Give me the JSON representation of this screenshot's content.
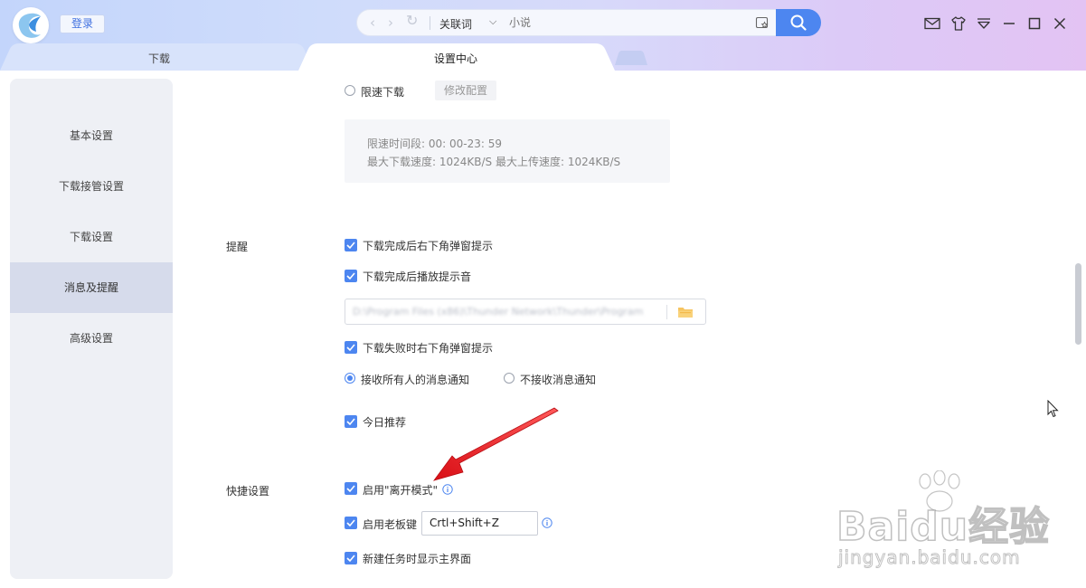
{
  "titlebar": {
    "login_label": "登录",
    "search": {
      "type_label": "关联词",
      "placeholder": "小说"
    }
  },
  "tabs": [
    {
      "label": "下载"
    },
    {
      "label": "设置中心"
    }
  ],
  "sidebar": {
    "items": [
      {
        "label": "基本设置"
      },
      {
        "label": "下载接管设置"
      },
      {
        "label": "下载设置"
      },
      {
        "label": "消息及提醒"
      },
      {
        "label": "高级设置"
      }
    ],
    "active_index": 3
  },
  "speed_limit": {
    "radio_label": "限速下载",
    "modify_label": "修改配置",
    "period_line": "限速时间段:   00: 00-23: 59",
    "speeds_line": "最大下载速度: 1024KB/S     最大上传速度: 1024KB/S"
  },
  "reminder": {
    "section_label": "提醒",
    "complete_popup": "下载完成后右下角弹窗提示",
    "complete_sound": "下载完成后播放提示音",
    "sound_path": "D:\\Program Files (x86)\\Thunder Network\\Thunder\\Program",
    "fail_popup": "下载失败时右下角弹窗提示",
    "receive_all": "接收所有人的消息通知",
    "receive_none": "不接收消息通知",
    "today_recommend": "今日推荐"
  },
  "quick": {
    "section_label": "快捷设置",
    "away_mode": "启用\"离开模式\"",
    "boss_key": "启用老板键",
    "boss_key_value": "Crtl+Shift+Z",
    "show_main": "新建任务时显示主界面"
  },
  "watermark": {
    "brand": "Baidu经验",
    "url": "jingyan.baidu.com"
  },
  "colors": {
    "accent": "#4d86f0",
    "annotation_arrow": "#e8141a"
  }
}
